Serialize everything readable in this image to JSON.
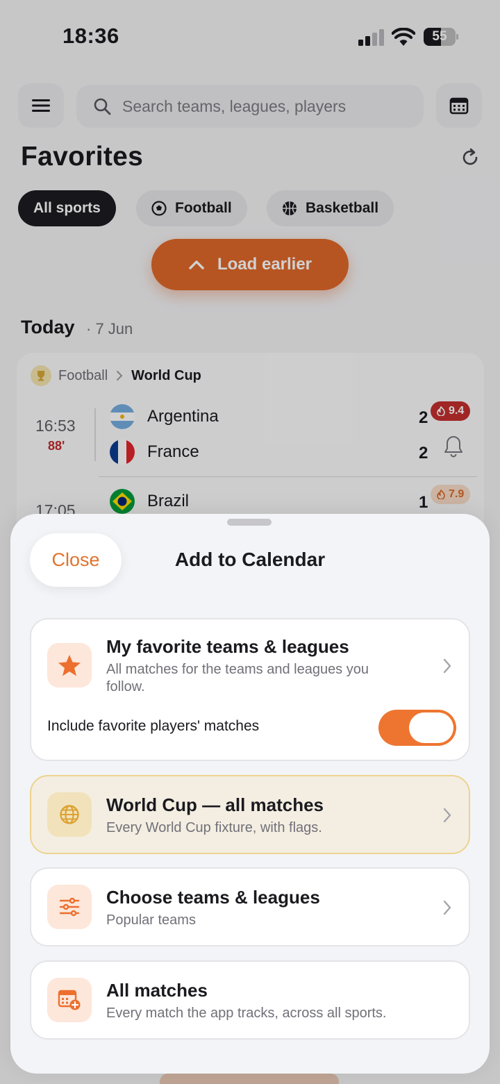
{
  "status_bar": {
    "time": "18:36",
    "battery": "55",
    "battery_level_percent": 55
  },
  "header": {
    "search_placeholder": "Search teams, leagues, players",
    "title": "Favorites"
  },
  "filters": [
    {
      "label": "All sports",
      "active": true
    },
    {
      "label": "Football",
      "active": false
    },
    {
      "label": "Basketball",
      "active": false
    }
  ],
  "load_earlier_label": "Load earlier",
  "day": {
    "label": "Today",
    "date": "· 7 Jun"
  },
  "match_card": {
    "sport": "Football",
    "league": "World Cup",
    "matches": [
      {
        "time": "16:53",
        "minute": "88'",
        "teams": [
          {
            "name": "Argentina",
            "score": "2"
          },
          {
            "name": "France",
            "score": "2"
          }
        ],
        "rating": "9.4"
      },
      {
        "time": "17:05",
        "teams": [
          {
            "name": "Brazil",
            "score": "1"
          }
        ],
        "rating": "7.9"
      }
    ]
  },
  "sheet": {
    "close_label": "Close",
    "title": "Add to Calendar",
    "options": [
      {
        "title": "My favorite teams & leagues",
        "subtitle": "All matches for the teams and leagues you follow.",
        "toggle_label": "Include favorite players' matches",
        "toggle_on": true
      },
      {
        "title": "World Cup — all matches",
        "subtitle": "Every World Cup fixture, with flags."
      },
      {
        "title": "Choose teams & leagues",
        "subtitle": "Popular teams"
      },
      {
        "title": "All matches",
        "subtitle": "Every match the app tracks, across all sports."
      }
    ]
  },
  "colors": {
    "accent": "#e0742f",
    "live_red": "#c42f2f",
    "highlight_bg": "#f4eee2",
    "highlight_border": "#ecd38f"
  },
  "icons": {
    "menu": "hamburger-icon",
    "search": "search-icon",
    "calendar": "calendar-icon",
    "refresh": "refresh-icon",
    "football": "football-icon",
    "basketball": "basketball-icon",
    "chevron_up": "chevron-up-icon",
    "trophy": "trophy-icon",
    "bell": "bell-icon",
    "star": "star-icon",
    "globe": "globe-icon",
    "sliders": "sliders-icon",
    "calendar_add": "calendar-add-icon",
    "chevron_right": "chevron-right-icon",
    "flame": "flame-icon"
  }
}
